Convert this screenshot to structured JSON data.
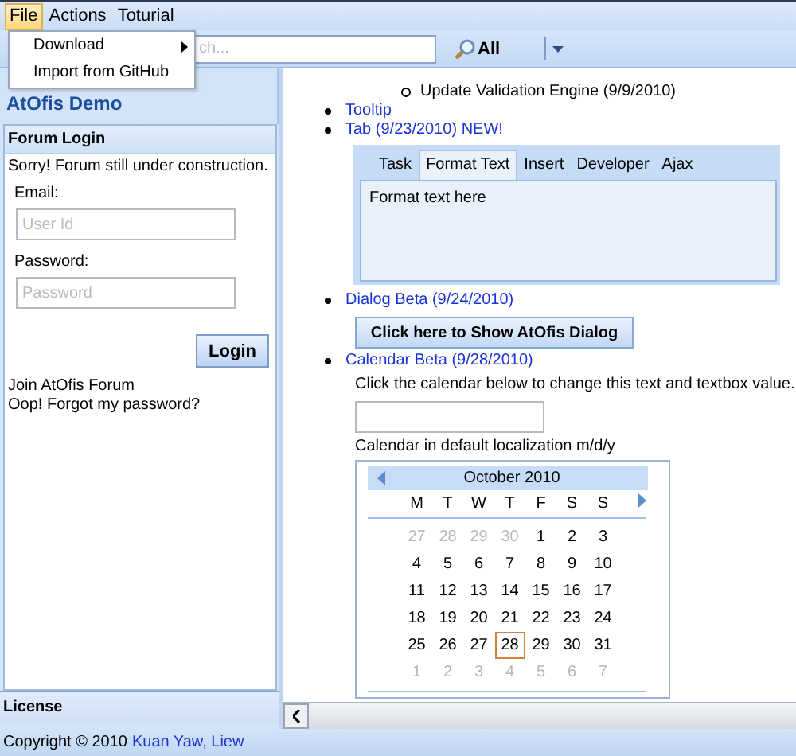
{
  "menu_bar": [
    {
      "label": "File",
      "selected": true
    },
    {
      "label": "Actions",
      "selected": false
    },
    {
      "label": "Toturial",
      "selected": false
    }
  ],
  "file_menu": [
    {
      "label": "Download",
      "submenu": true
    },
    {
      "label": "Import from GitHub",
      "submenu": false
    }
  ],
  "toolbar": {
    "search": {
      "placeholder": "ch..."
    },
    "scope_button": "All"
  },
  "sidebar": {
    "title": "AtOfis Demo",
    "panel": {
      "title": "Forum Login",
      "notice": "Sorry! Forum still under construction.",
      "email_label": "Email:",
      "email_placeholder": "User Id",
      "password_label": "Password:",
      "password_placeholder": "Password",
      "login_button": "Login",
      "links": [
        "Join AtOfis Forum",
        "Oop! Forgot my password?"
      ]
    },
    "bottom_panel": "License"
  },
  "content": {
    "nested_item": "Update Validation Engine (9/9/2010)",
    "tooltip_link": "Tooltip",
    "tab_demo": {
      "link": "Tab (9/23/2010) NEW!",
      "tabs": [
        {
          "label": "Task",
          "selected": false
        },
        {
          "label": "Format Text",
          "selected": true
        },
        {
          "label": "Insert",
          "selected": false
        },
        {
          "label": "Developer",
          "selected": false
        },
        {
          "label": "Ajax",
          "selected": false
        }
      ],
      "body": "Format text here"
    },
    "dialog_demo": {
      "link": "Dialog Beta (9/24/2010)",
      "button": "Click here to Show AtOfis Dialog"
    },
    "calendar_demo": {
      "link": "Calendar Beta (9/28/2010)",
      "instruction": "Click the calendar below to change this text and textbox value.",
      "caption": "Calendar in default localization m/d/y",
      "calendar": {
        "month": "October 2010",
        "weekdays": [
          "M",
          "T",
          "W",
          "T",
          "F",
          "S",
          "S"
        ],
        "days": [
          {
            "day": "27",
            "in_month": false,
            "selected": false
          },
          {
            "day": "28",
            "in_month": false,
            "selected": false
          },
          {
            "day": "29",
            "in_month": false,
            "selected": false
          },
          {
            "day": "30",
            "in_month": false,
            "selected": false
          },
          {
            "day": "1",
            "in_month": true,
            "selected": false
          },
          {
            "day": "2",
            "in_month": true,
            "selected": false
          },
          {
            "day": "3",
            "in_month": true,
            "selected": false
          },
          {
            "day": "4",
            "in_month": true,
            "selected": false
          },
          {
            "day": "5",
            "in_month": true,
            "selected": false
          },
          {
            "day": "6",
            "in_month": true,
            "selected": false
          },
          {
            "day": "7",
            "in_month": true,
            "selected": false
          },
          {
            "day": "8",
            "in_month": true,
            "selected": false
          },
          {
            "day": "9",
            "in_month": true,
            "selected": false
          },
          {
            "day": "10",
            "in_month": true,
            "selected": false
          },
          {
            "day": "11",
            "in_month": true,
            "selected": false
          },
          {
            "day": "12",
            "in_month": true,
            "selected": false
          },
          {
            "day": "13",
            "in_month": true,
            "selected": false
          },
          {
            "day": "14",
            "in_month": true,
            "selected": false
          },
          {
            "day": "15",
            "in_month": true,
            "selected": false
          },
          {
            "day": "16",
            "in_month": true,
            "selected": false
          },
          {
            "day": "17",
            "in_month": true,
            "selected": false
          },
          {
            "day": "18",
            "in_month": true,
            "selected": false
          },
          {
            "day": "19",
            "in_month": true,
            "selected": false
          },
          {
            "day": "20",
            "in_month": true,
            "selected": false
          },
          {
            "day": "21",
            "in_month": true,
            "selected": false
          },
          {
            "day": "22",
            "in_month": true,
            "selected": false
          },
          {
            "day": "23",
            "in_month": true,
            "selected": false
          },
          {
            "day": "24",
            "in_month": true,
            "selected": false
          },
          {
            "day": "25",
            "in_month": true,
            "selected": false
          },
          {
            "day": "26",
            "in_month": true,
            "selected": false
          },
          {
            "day": "27",
            "in_month": true,
            "selected": false
          },
          {
            "day": "28",
            "in_month": true,
            "selected": true
          },
          {
            "day": "29",
            "in_month": true,
            "selected": false
          },
          {
            "day": "30",
            "in_month": true,
            "selected": false
          },
          {
            "day": "31",
            "in_month": true,
            "selected": false
          },
          {
            "day": "1",
            "in_month": false,
            "selected": false
          },
          {
            "day": "2",
            "in_month": false,
            "selected": false
          },
          {
            "day": "3",
            "in_month": false,
            "selected": false
          },
          {
            "day": "4",
            "in_month": false,
            "selected": false
          },
          {
            "day": "5",
            "in_month": false,
            "selected": false
          },
          {
            "day": "6",
            "in_month": false,
            "selected": false
          },
          {
            "day": "7",
            "in_month": false,
            "selected": false
          }
        ]
      }
    }
  },
  "footer": {
    "text": "Copyright © 2010",
    "link": "Kuan Yaw, Liew"
  }
}
